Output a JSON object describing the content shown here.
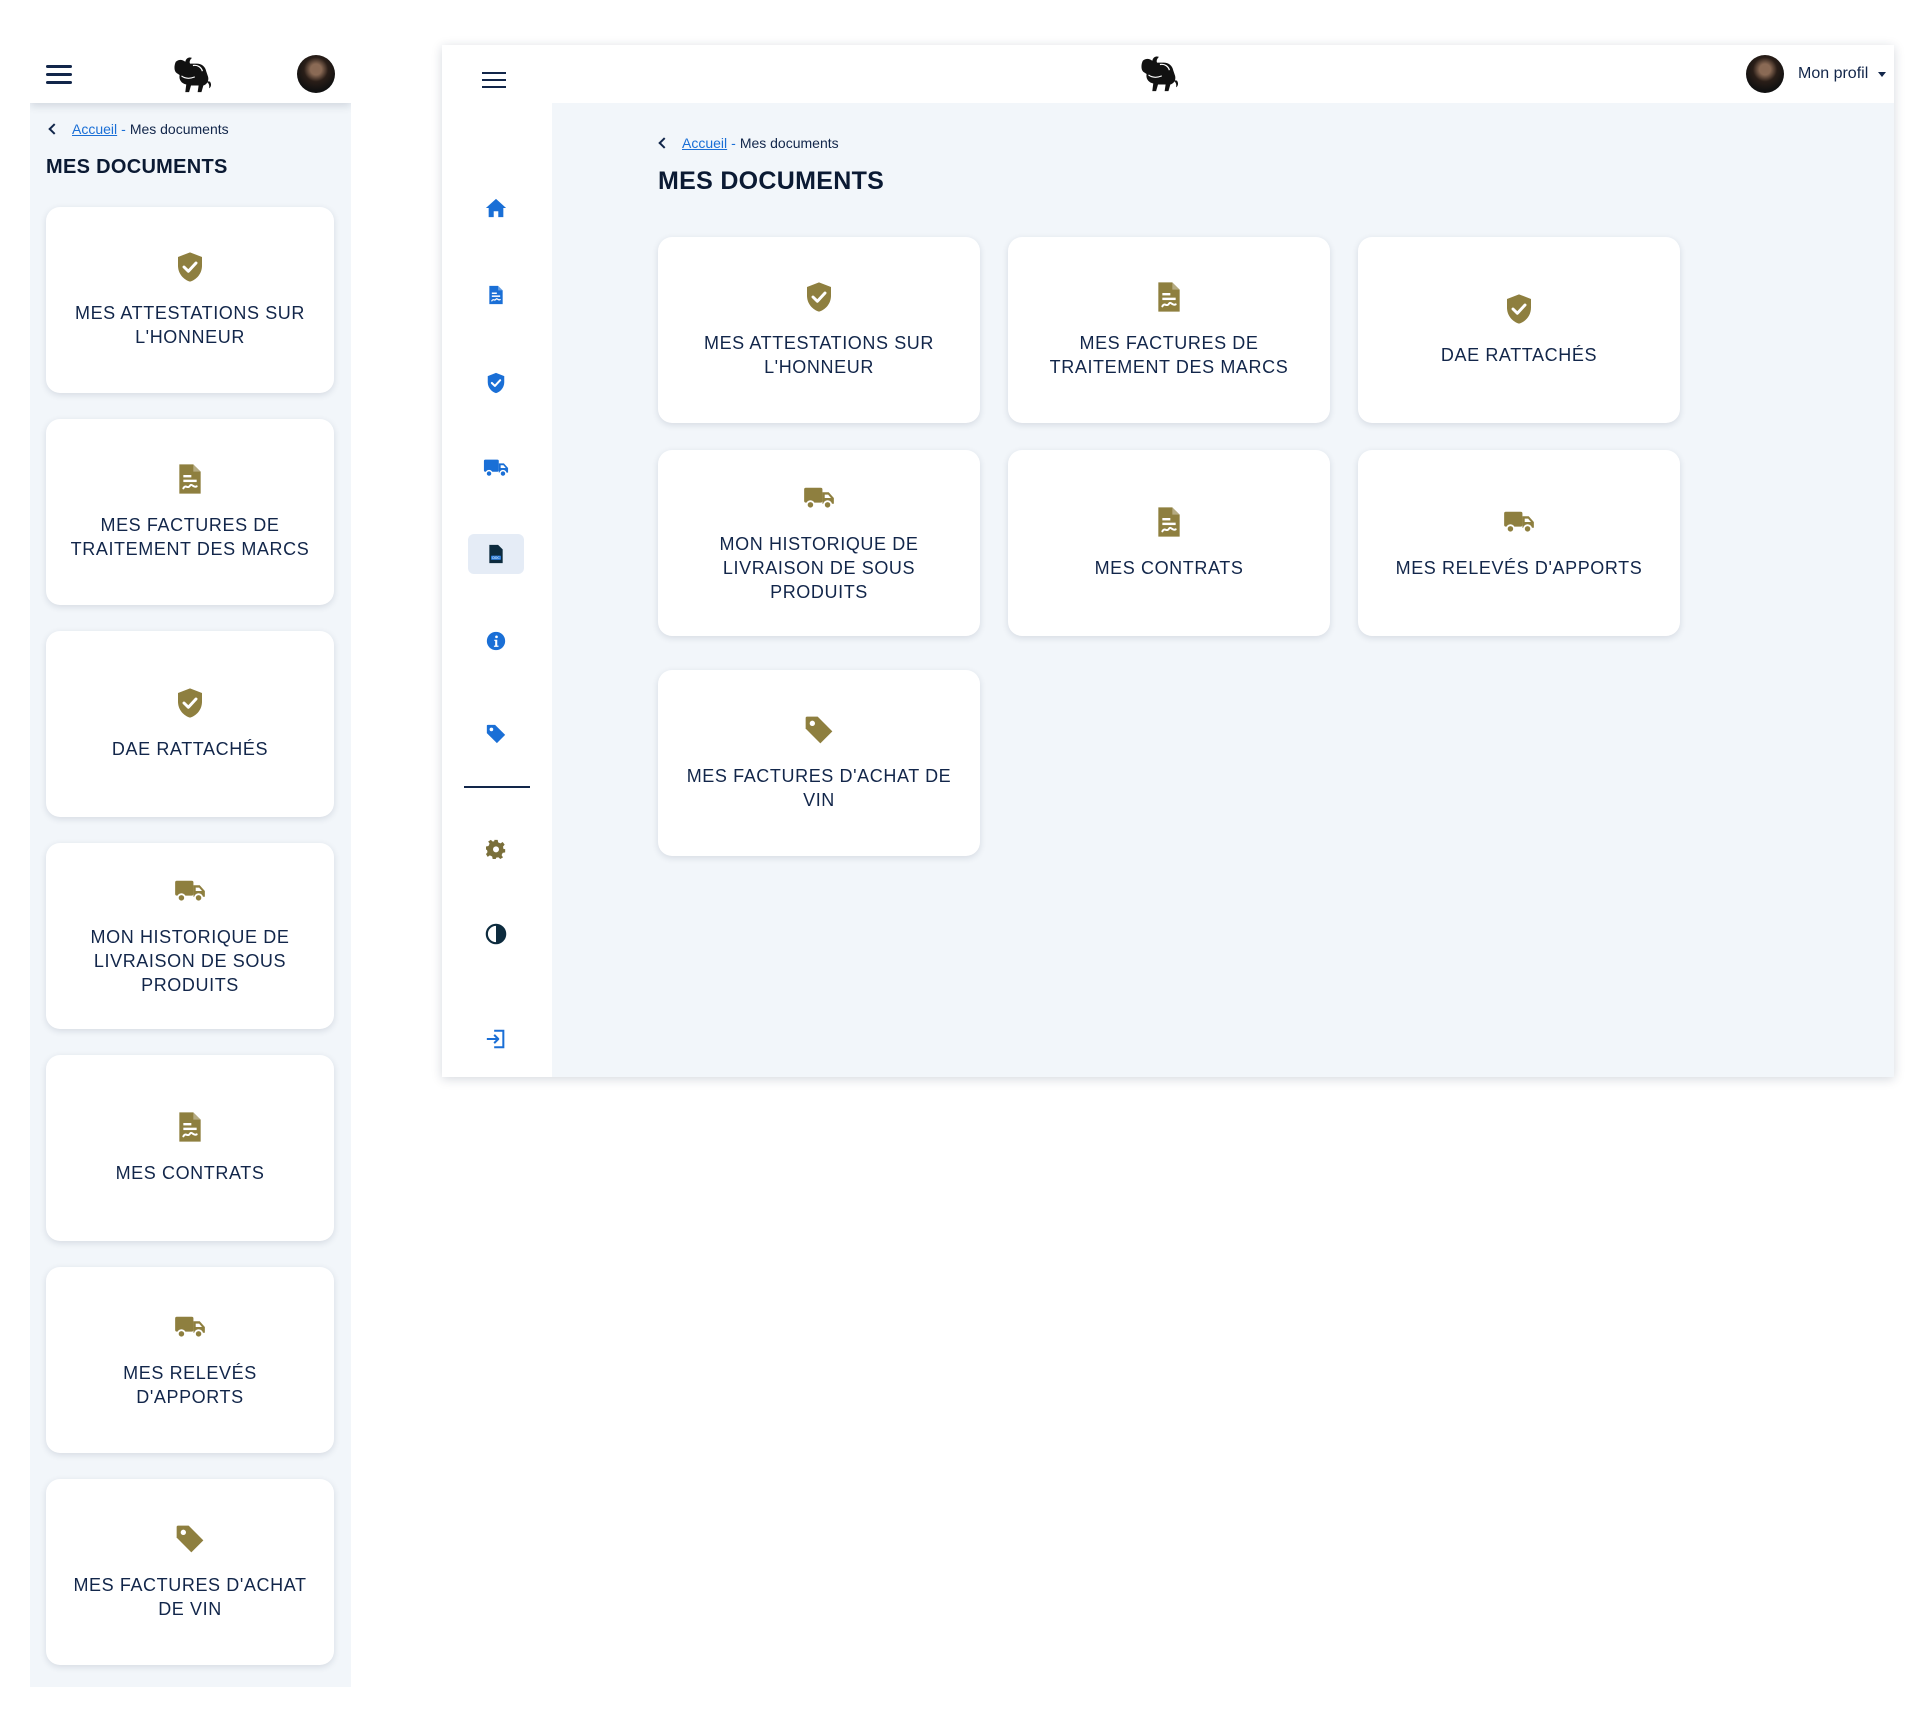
{
  "colors": {
    "accent_gold": "#8e7f3f",
    "nav_blue": "#1a6fd6",
    "navy": "#12264a",
    "background": "#f2f6fa"
  },
  "breadcrumb": {
    "home": "Accueil",
    "separator": "-",
    "current": "Mes documents"
  },
  "page_title": "MES DOCUMENTS",
  "profile": {
    "label": "Mon profil"
  },
  "sidebar_icons": [
    "home-icon",
    "document-icon",
    "shield-icon",
    "truck-icon",
    "doc-file-icon",
    "info-icon",
    "tag-icon",
    "gear-icon",
    "contrast-icon",
    "logout-icon"
  ],
  "cards": [
    {
      "label": "MES ATTESTATIONS SUR L'HONNEUR",
      "icon": "shield-check-icon"
    },
    {
      "label": "MES FACTURES DE TRAITEMENT DES MARCS",
      "icon": "document-signed-icon"
    },
    {
      "label": "DAE RATTACHÉS",
      "icon": "shield-check-icon"
    },
    {
      "label": "MON HISTORIQUE DE LIVRAISON DE SOUS PRODUITS",
      "icon": "truck-icon"
    },
    {
      "label": "MES CONTRATS",
      "icon": "document-signed-icon"
    },
    {
      "label": "MES RELEVÉS D'APPORTS",
      "icon": "truck-icon"
    },
    {
      "label": "MES FACTURES D'ACHAT DE VIN",
      "icon": "tag-icon"
    }
  ]
}
